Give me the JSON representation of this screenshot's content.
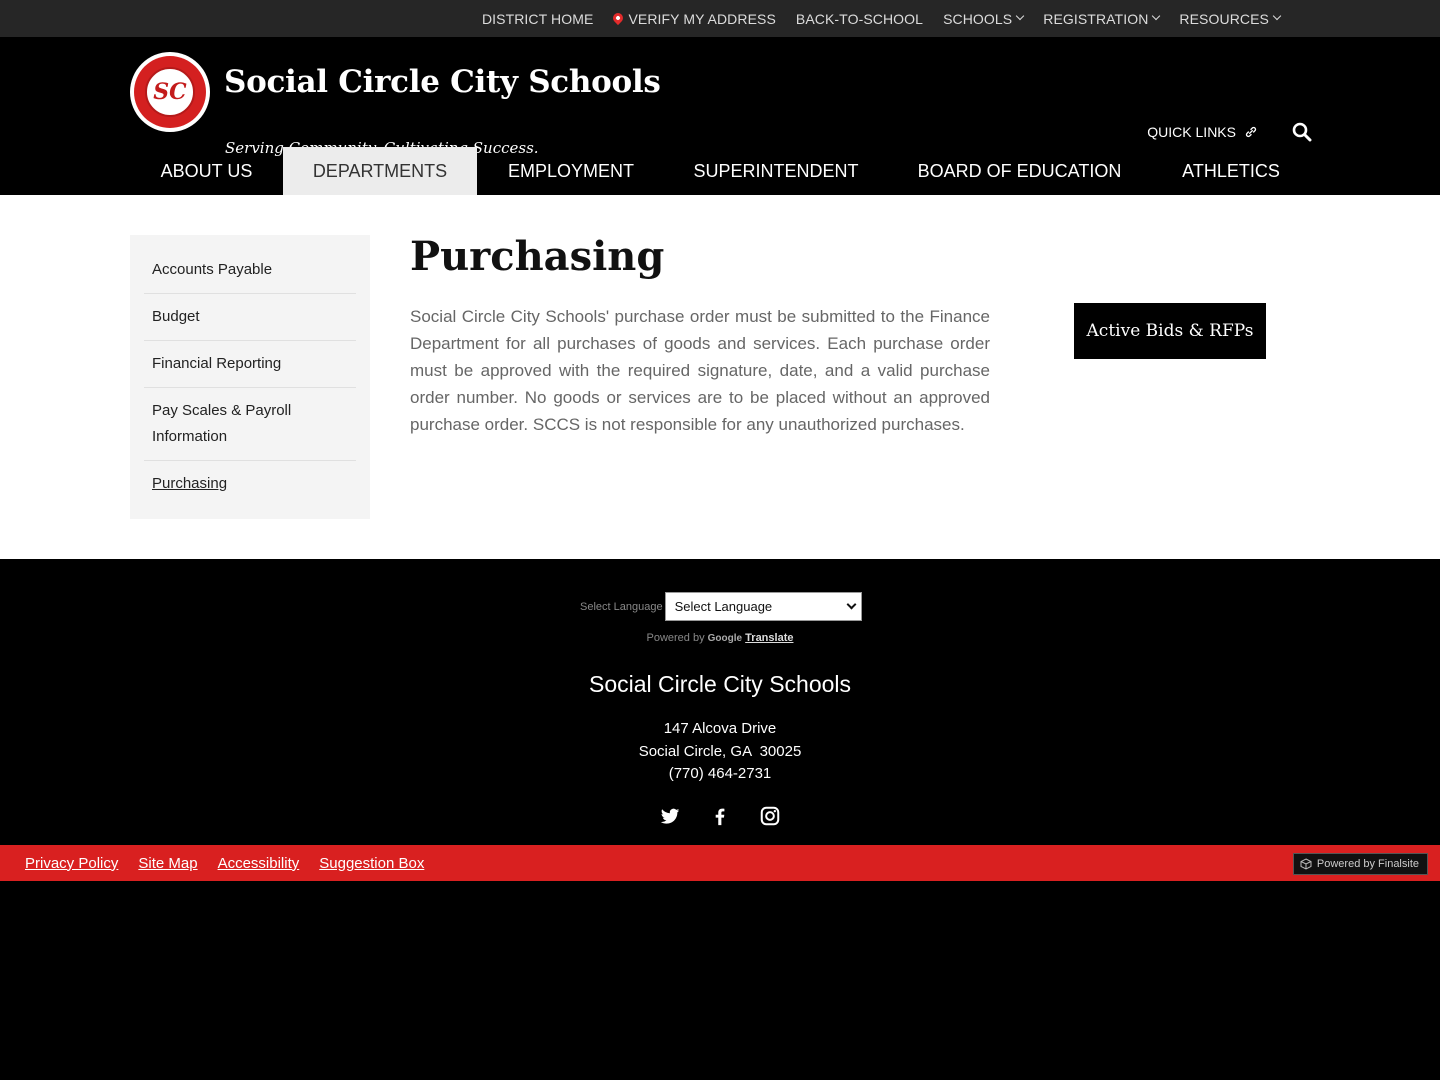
{
  "utility_nav": {
    "items": [
      {
        "label": "DISTRICT HOME"
      },
      {
        "label": "VERIFY MY ADDRESS",
        "icon": "map-pin-icon"
      },
      {
        "label": "BACK-TO-SCHOOL"
      },
      {
        "label": "SCHOOLS",
        "dropdown": true
      },
      {
        "label": "REGISTRATION",
        "dropdown": true
      },
      {
        "label": "RESOURCES",
        "dropdown": true
      }
    ]
  },
  "header": {
    "logo_initials": "SC",
    "title": "Social Circle City Schools",
    "tagline": "Serving Community. Cultivating Success.",
    "quick_links": "QUICK LINKS",
    "brand_red": "#d92020"
  },
  "main_nav": {
    "items": [
      {
        "label": "ABOUT US",
        "active": false
      },
      {
        "label": "DEPARTMENTS",
        "active": true
      },
      {
        "label": "EMPLOYMENT",
        "active": false
      },
      {
        "label": "SUPERINTENDENT",
        "active": false
      },
      {
        "label": "BOARD OF EDUCATION",
        "active": false
      },
      {
        "label": "ATHLETICS",
        "active": false
      }
    ]
  },
  "side_nav": {
    "items": [
      {
        "label": "Accounts Payable"
      },
      {
        "label": "Budget"
      },
      {
        "label": "Financial Reporting"
      },
      {
        "label": "Pay Scales & Payroll Information"
      },
      {
        "label": "Purchasing",
        "current": true
      }
    ]
  },
  "main": {
    "title": "Purchasing",
    "body": "Social Circle City Schools' purchase order must be submitted to the Finance Department for all purchases of goods and services.  Each purchase order must be approved with the required signature, date, and a valid purchase order number.  No goods or services are to be placed without an approved purchase order.  SCCS is not responsible for any unauthorized purchases.",
    "bids_button": "Active Bids & RFPs"
  },
  "footer": {
    "language_label": "Select Language",
    "language_selected": "Select Language",
    "powered_by": "Powered by",
    "google": "Google",
    "translate": "Translate",
    "school_name": "Social Circle City Schools",
    "address_line1": "147 Alcova Drive",
    "address_line2": "Social Circle, GA  30025",
    "phone": "(770) 464-2731",
    "social": [
      "twitter-icon",
      "facebook-icon",
      "instagram-icon"
    ]
  },
  "bottom_bar": {
    "links": [
      "Privacy Policy",
      "Site Map",
      "Accessibility",
      "Suggestion Box"
    ],
    "finalsite": "Powered by Finalsite"
  }
}
